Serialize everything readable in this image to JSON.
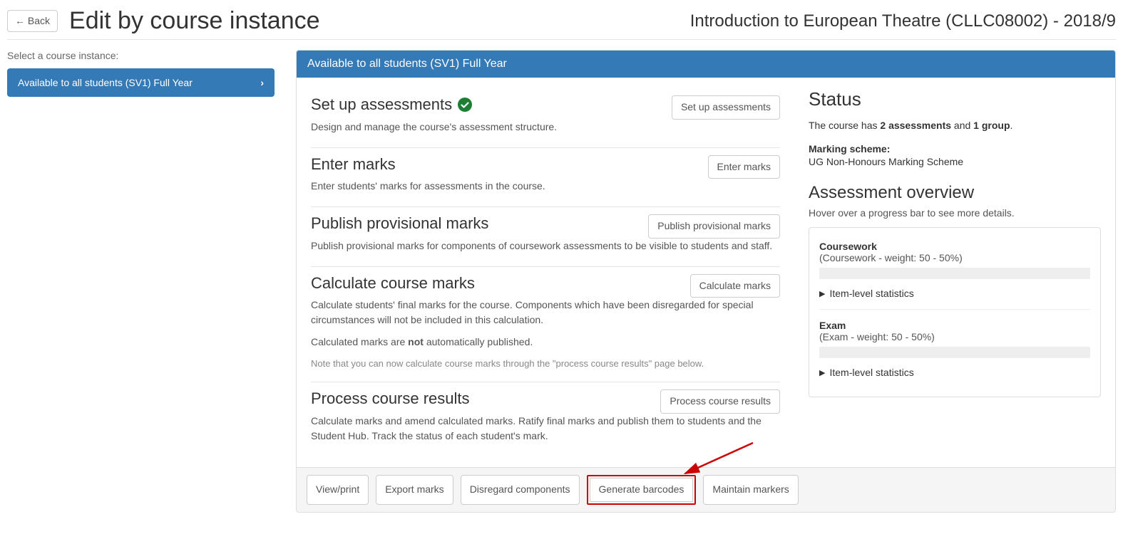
{
  "header": {
    "back_label": "Back",
    "page_title": "Edit by course instance",
    "course_title": "Introduction to European Theatre (CLLC08002) - 2018/9"
  },
  "sidebar": {
    "label": "Select a course instance:",
    "items": [
      {
        "label": "Available to all students (SV1) Full Year"
      }
    ]
  },
  "panel": {
    "heading": "Available to all students (SV1) Full Year"
  },
  "sections": [
    {
      "title": "Set up assessments",
      "button": "Set up assessments",
      "desc": "Design and manage the course's assessment structure.",
      "has_check": true
    },
    {
      "title": "Enter marks",
      "button": "Enter marks",
      "desc": "Enter students' marks for assessments in the course."
    },
    {
      "title": "Publish provisional marks",
      "button": "Publish provisional marks",
      "desc": "Publish provisional marks for components of coursework assessments to be visible to students and staff."
    },
    {
      "title": "Calculate course marks",
      "button": "Calculate marks",
      "desc": "Calculate students' final marks for the course. Components which have been disregarded for special circumstances will not be included in this calculation.",
      "desc2_pre": "Calculated marks are ",
      "desc2_bold": "not",
      "desc2_post": " automatically published.",
      "note": "Note that you can now calculate course marks through the \"process course results\" page below."
    },
    {
      "title": "Process course results",
      "button": "Process course results",
      "desc": "Calculate marks and amend calculated marks. Ratify final marks and publish them to students and the Student Hub. Track the status of each student's mark."
    }
  ],
  "status": {
    "title": "Status",
    "line_pre": "The course has ",
    "assessments_bold": "2 assessments",
    "line_mid": " and ",
    "groups_bold": "1 group",
    "line_post": ".",
    "scheme_label": "Marking scheme:",
    "scheme_value": "UG Non-Honours Marking Scheme"
  },
  "overview": {
    "title": "Assessment overview",
    "hint": "Hover over a progress bar to see more details.",
    "items": [
      {
        "name": "Coursework",
        "sub": "(Coursework - weight: 50 - 50%)",
        "stats_label": "Item-level statistics"
      },
      {
        "name": "Exam",
        "sub": "(Exam - weight: 50 - 50%)",
        "stats_label": "Item-level statistics"
      }
    ]
  },
  "footer": {
    "buttons": [
      "View/print",
      "Export marks",
      "Disregard components",
      "Generate barcodes",
      "Maintain markers"
    ],
    "highlight_index": 3
  }
}
